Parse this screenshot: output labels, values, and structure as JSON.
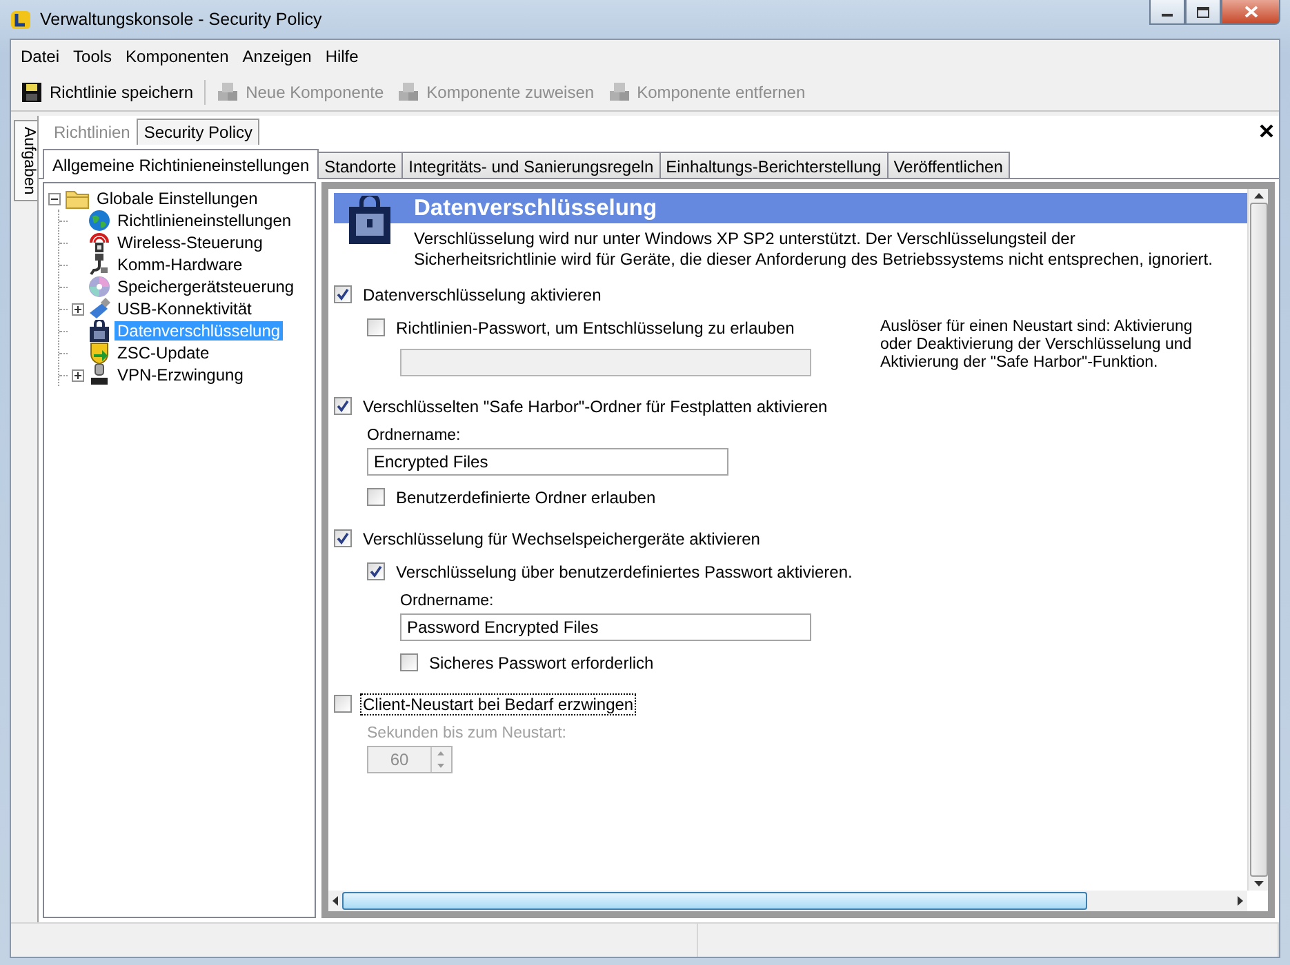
{
  "window": {
    "title": "Verwaltungskonsole - Security Policy"
  },
  "menu": [
    "Datei",
    "Tools",
    "Komponenten",
    "Anzeigen",
    "Hilfe"
  ],
  "toolbar": [
    {
      "label": "Richtlinie speichern",
      "disabled": false
    },
    {
      "label": "Neue Komponente",
      "disabled": true
    },
    {
      "label": "Komponente zuweisen",
      "disabled": true
    },
    {
      "label": "Komponente entfernen",
      "disabled": true
    }
  ],
  "side_tab": "Aufgaben",
  "doc_tabs": [
    {
      "label": "Richtlinien",
      "selected": false
    },
    {
      "label": "Security Policy",
      "selected": true
    }
  ],
  "tabs": [
    {
      "label": "Allgemeine Richtinieneinstellungen",
      "selected": true
    },
    {
      "label": "Standorte",
      "selected": false
    },
    {
      "label": "Integritäts- und Sanierungsregeln",
      "selected": false
    },
    {
      "label": "Einhaltungs-Berichterstellung",
      "selected": false
    },
    {
      "label": "Veröffentlichen",
      "selected": false
    }
  ],
  "tree": [
    {
      "label": "Globale Einstellungen",
      "expanded": true,
      "selected": false,
      "children": [
        {
          "label": "Richtlinieneinstellungen",
          "selected": false
        },
        {
          "label": "Wireless-Steuerung",
          "selected": false
        },
        {
          "label": "Komm-Hardware",
          "selected": false
        },
        {
          "label": "Speichergerätsteuerung",
          "selected": false
        },
        {
          "label": "USB-Konnektivität",
          "selected": false,
          "expanded": false
        },
        {
          "label": "Datenverschlüsselung",
          "selected": true
        },
        {
          "label": "ZSC-Update",
          "selected": false
        },
        {
          "label": "VPN-Erzwingung",
          "selected": false,
          "expanded": false
        }
      ]
    }
  ],
  "section": {
    "title": "Datenverschlüsselung",
    "description": "Verschlüsselung wird nur unter Windows XP SP2 unterstützt. Der Verschlüsselungsteil der Sicherheitsrichtlinie wird für Geräte, die dieser Anforderung des Betriebssystems nicht entsprechen, ignoriert.",
    "note": "Auslöser für einen Neustart sind: Aktivierung oder Deaktivierung der Verschlüsselung und Aktivierung der \"Safe Harbor\"-Funktion.",
    "controls": [
      {
        "kind": "checkbox",
        "label": "Datenverschlüsselung aktivieren",
        "checked": true,
        "focused": false,
        "children": [
          {
            "kind": "checkbox",
            "label": "Richtlinien-Passwort, um Entschlüsselung zu erlauben",
            "checked": false,
            "focused": false,
            "children": [
              {
                "kind": "field",
                "disabled": true
              }
            ]
          }
        ]
      },
      {
        "kind": "checkbox",
        "label": "Verschlüsselten \"Safe Harbor\"-Ordner für Festplatten aktivieren",
        "checked": true,
        "focused": false,
        "children": [
          {
            "kind": "field",
            "label": "Ordnername:",
            "value": "Encrypted Files",
            "disabled": false
          },
          {
            "kind": "checkbox",
            "label": "Benutzerdefinierte Ordner erlauben",
            "checked": false,
            "focused": false
          }
        ]
      },
      {
        "kind": "checkbox",
        "label": "Verschlüsselung für Wechselspeichergeräte aktivieren",
        "checked": true,
        "focused": false,
        "children": [
          {
            "kind": "checkbox",
            "label": "Verschlüsselung über benutzerdefiniertes Passwort aktivieren.",
            "checked": true,
            "focused": false,
            "children": [
              {
                "kind": "field",
                "label": "Ordnername:",
                "value": "Password Encrypted Files",
                "disabled": false
              },
              {
                "kind": "checkbox",
                "label": "Sicheres Passwort erforderlich",
                "checked": false,
                "focused": false
              }
            ]
          }
        ]
      },
      {
        "kind": "checkbox",
        "label": "Client-Neustart bei Bedarf erzwingen",
        "checked": false,
        "focused": true,
        "children": [
          {
            "kind": "spinner",
            "label": "Sekunden bis zum Neustart:",
            "value": "60",
            "disabled": true
          }
        ]
      }
    ]
  }
}
